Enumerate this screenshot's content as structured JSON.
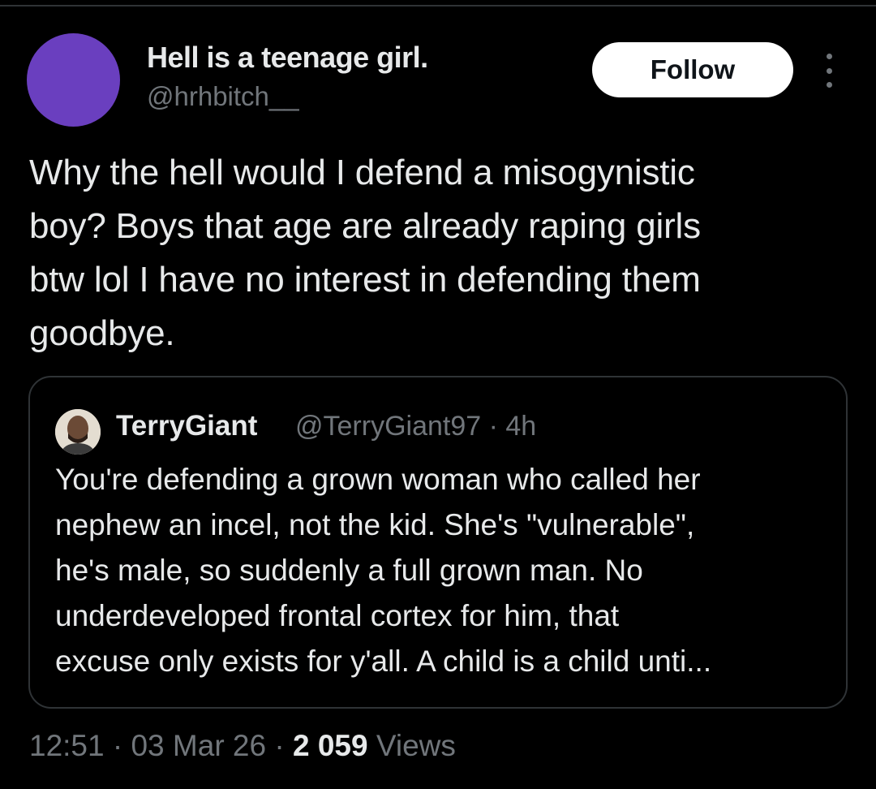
{
  "colors": {
    "background": "#000000",
    "avatar": "#6a3fbf",
    "primary_text": "#e7e9ea",
    "secondary_text": "#71767b",
    "follow_button_bg": "#ffffff",
    "border": "#2f3336"
  },
  "post": {
    "author": {
      "display_name": "Hell is a teenage girl.",
      "handle": "@hrhbitch__"
    },
    "follow_label": "Follow",
    "more_icon": "more-vertical-icon",
    "text": "Why the hell would I defend a misogynistic\nboy? Boys that age are already raping girls\nbtw lol I have no interest in defending them\ngoodbye."
  },
  "quote": {
    "author": {
      "display_name": "TerryGiant",
      "handle_time": "@TerryGiant97 · 4h"
    },
    "text": "You're defending a grown woman who called her\nnephew an incel, not the kid. She's \"vulnerable\",\nhe's male, so suddenly a full grown man. No\nunderdeveloped frontal cortex for him, that\nexcuse only exists for y'all. A child is a child unti..."
  },
  "meta": {
    "time": "12:51",
    "date": "03 Mar 26",
    "views_count": "2 059",
    "views_label": "Views",
    "separator": " · "
  }
}
